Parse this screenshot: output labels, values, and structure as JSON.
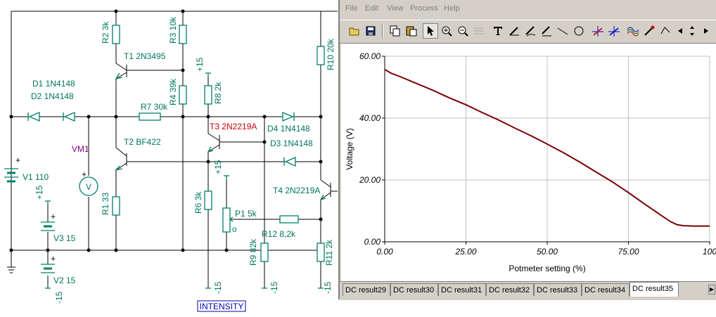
{
  "schematic": {
    "components": {
      "r2": "R2 3k",
      "r3": "R3 10k",
      "t1": "T1 2N3495",
      "r4": "R4 39k",
      "r8": "R8 2k",
      "r10": "R10 20k",
      "d1": "D1 1N4148",
      "d2": "D2 1N4148",
      "r7": "R7 30k",
      "t3": "T3 2N2219A",
      "d4": "D4 1N4148",
      "vm1": "VM1",
      "t2": "T2 BF422",
      "d3": "D3 1N4148",
      "v1": "V1 110",
      "t4": "T4 2N2219A",
      "r1": "R1 33",
      "r6": "R6 3k",
      "p1": "P1 5k",
      "v3": "V3 15",
      "r12": "R12 8,2k",
      "r9": "R9 82k",
      "r11": "R11 2k",
      "v2": "V2 15"
    },
    "supply_labels": {
      "plus15_top": "+15",
      "plus15_pot": "+15",
      "plus15_left": "+15",
      "minus15_r6": "-15",
      "minus15_r9": "-15",
      "minus15_r11": "-15",
      "minus15_v2": "-15"
    },
    "voltmeter_symbol": "V",
    "pot_marker": "o",
    "plus_sign": "+",
    "intensity_label": "INTENSITY"
  },
  "window": {
    "menu": [
      "File",
      "Edit",
      "View",
      "Process",
      "Help"
    ],
    "toolbar_icons": [
      "open-icon",
      "save-icon",
      "copy-icon",
      "paste-icon",
      "pointer-icon",
      "zoom-in-icon",
      "zoom-out-icon",
      "grid-icon",
      "text-icon",
      "pen-icon",
      "pen-alt-icon",
      "curve-tool-icon",
      "line-icon",
      "circle-icon",
      "cursor-a-icon",
      "cursor-b-icon",
      "waves-icon",
      "marker-icon",
      "step-icon",
      "scroll-left-icon",
      "scroll-updown-icon"
    ],
    "tabs": [
      "DC result29",
      "DC result30",
      "DC result31",
      "DC result32",
      "DC result33",
      "DC result34",
      "DC result35"
    ],
    "active_tab": "DC result35"
  },
  "chart_data": {
    "type": "line",
    "title": "",
    "xlabel": "Potmeter setting (%)",
    "ylabel": "Voltage (V)",
    "xlim": [
      0,
      100
    ],
    "ylim": [
      0,
      60
    ],
    "x_ticks": [
      "0.00",
      "25.00",
      "50.00",
      "75.00",
      "100"
    ],
    "y_ticks": [
      "0.00",
      "20.00",
      "40.00",
      "60.00"
    ],
    "grid": true,
    "line_color": "#7a0000",
    "x": [
      0,
      2,
      5,
      10,
      15,
      20,
      25,
      30,
      35,
      40,
      45,
      50,
      55,
      60,
      65,
      70,
      75,
      80,
      85,
      88,
      90,
      92,
      95,
      100
    ],
    "y": [
      55.7,
      54.5,
      53.3,
      51.1,
      48.9,
      46.5,
      44.3,
      41.8,
      39.4,
      36.8,
      34.3,
      31.6,
      28.8,
      25.8,
      22.6,
      19.4,
      15.9,
      12.2,
      8.6,
      6.5,
      5.5,
      5.2,
      5.1,
      5.1
    ]
  }
}
